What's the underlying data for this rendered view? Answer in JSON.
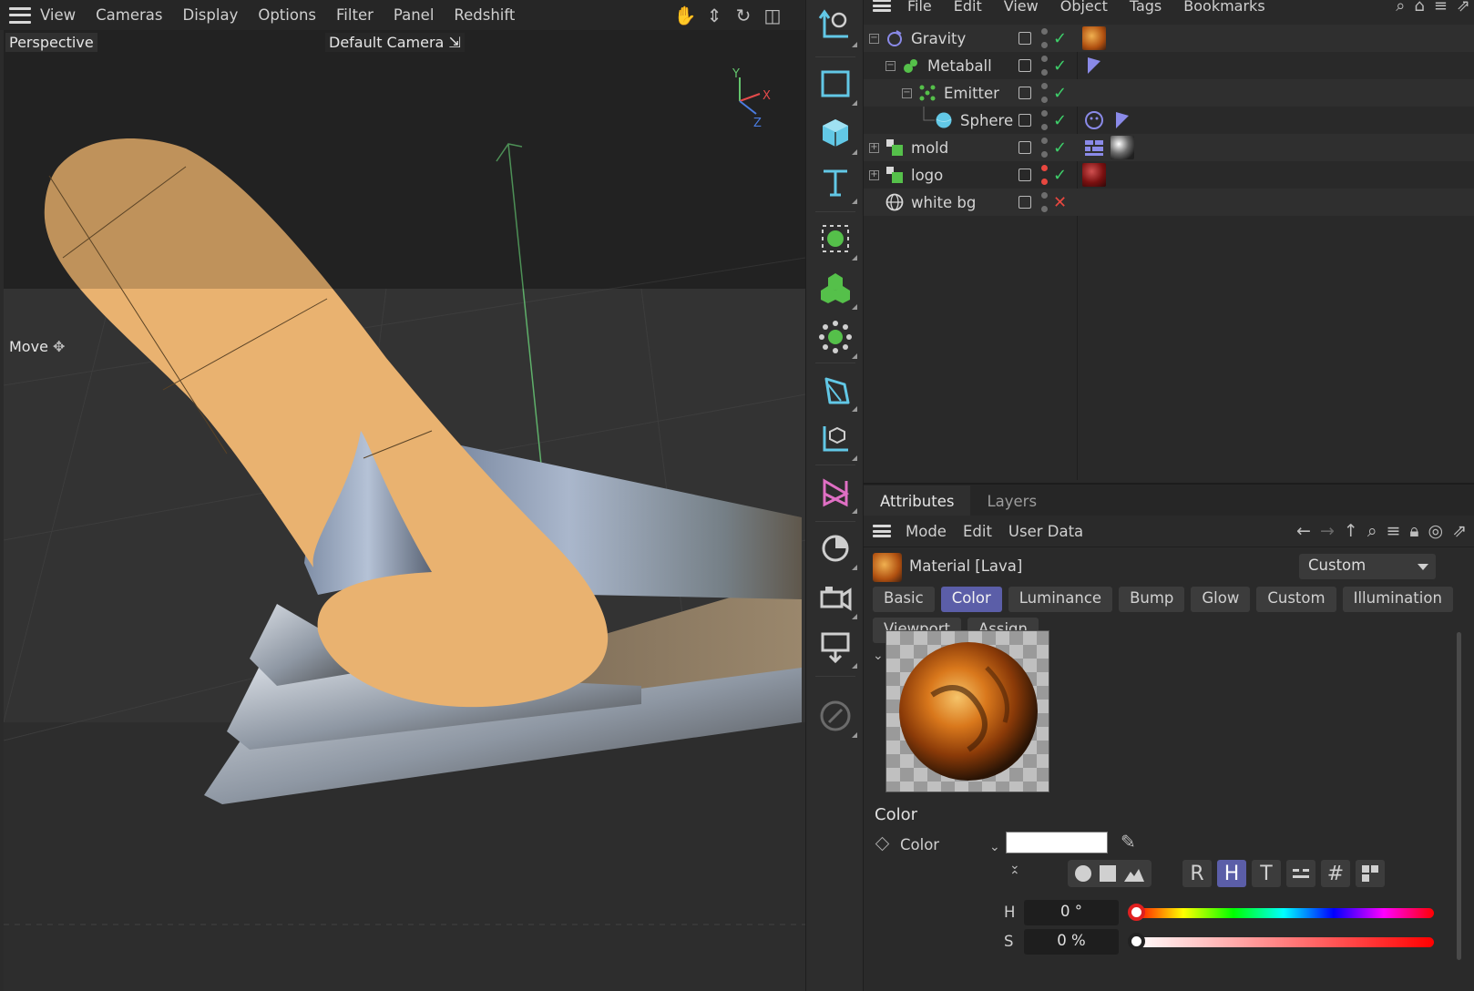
{
  "viewport": {
    "menu": [
      "View",
      "Cameras",
      "Display",
      "Options",
      "Filter",
      "Panel",
      "Redshift"
    ],
    "view_name": "Perspective",
    "camera": "Default Camera",
    "tool": "Move",
    "axis_labels": {
      "y": "Y",
      "x": "X",
      "z": "Z"
    }
  },
  "object_manager": {
    "menu": [
      "File",
      "Edit",
      "View",
      "Object",
      "Tags",
      "Bookmarks"
    ],
    "objects": [
      {
        "name": "Gravity"
      },
      {
        "name": "Metaball"
      },
      {
        "name": "Emitter"
      },
      {
        "name": "Sphere"
      },
      {
        "name": "mold"
      },
      {
        "name": "logo"
      },
      {
        "name": "white bg"
      }
    ]
  },
  "attributes": {
    "tabs": [
      "Attributes",
      "Layers"
    ],
    "menu": [
      "Mode",
      "Edit",
      "User Data"
    ],
    "material_title": "Material [Lava]",
    "mode_value": "Custom",
    "channel_tabs": [
      "Basic",
      "Color",
      "Luminance",
      "Bump",
      "Glow",
      "Custom",
      "Illumination",
      "Viewport",
      "Assign"
    ],
    "active_channel": "Color",
    "section_title": "Color",
    "color_param_label": "Color",
    "color_value": "#ffffff",
    "mode_buttons": [
      "R",
      "H",
      "T",
      "#"
    ],
    "active_mode_button": "H",
    "hue_label": "H",
    "hue_value": "0 °",
    "sat_label": "S",
    "sat_value": "0 %"
  },
  "colors": {
    "accent": "#5b5ea8",
    "check_green": "#3ecf6a",
    "cross_red": "#e8473f",
    "cyan_icon": "#62c8e6",
    "green_icon": "#55c04a"
  }
}
